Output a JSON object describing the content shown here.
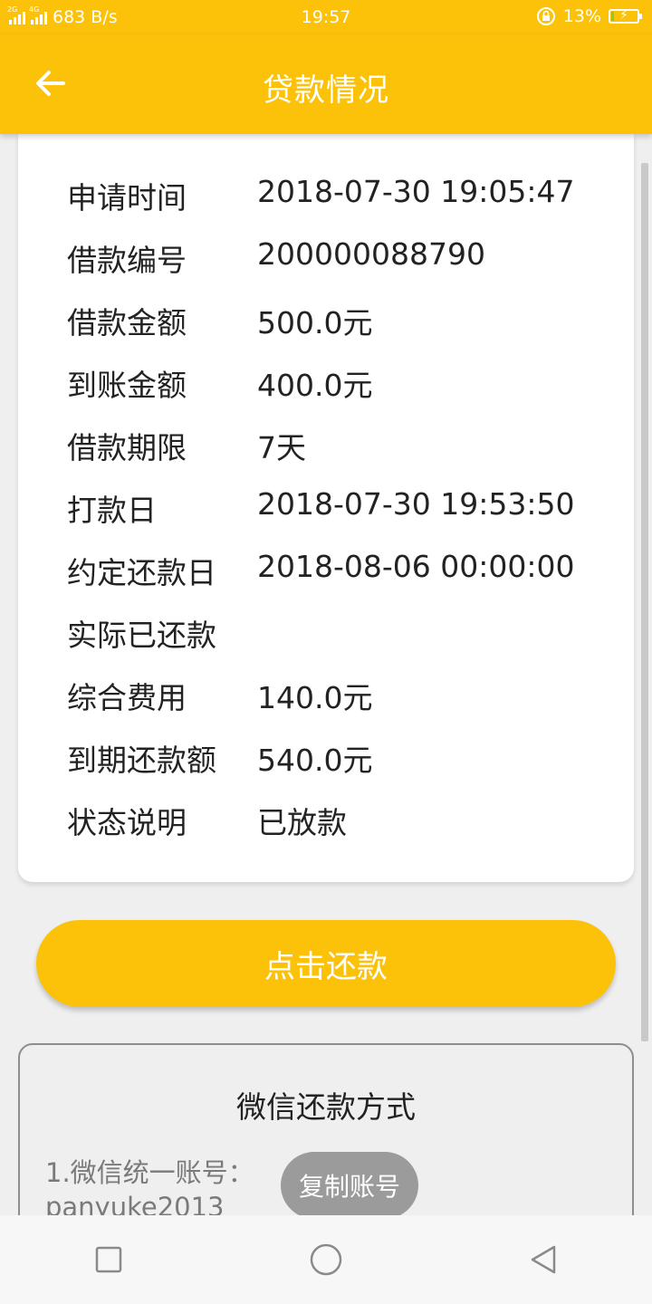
{
  "status_bar": {
    "net_speed": "683 B/s",
    "time": "19:57",
    "battery": "13%",
    "battery_level": 0.13,
    "signal_1_tag": "2G",
    "signal_2_tag": "4G"
  },
  "app_bar": {
    "title": "贷款情况",
    "back_icon": "arrow-left-icon"
  },
  "loan_details": [
    {
      "label": "申请时间",
      "value": "2018-07-30 19:05:47"
    },
    {
      "label": "借款编号",
      "value": "200000088790"
    },
    {
      "label": "借款金额",
      "value": "500.0元"
    },
    {
      "label": "到账金额",
      "value": "400.0元"
    },
    {
      "label": "借款期限",
      "value": "7天"
    },
    {
      "label": "打款日",
      "value": "2018-07-30 19:53:50"
    },
    {
      "label": "约定还款日",
      "value": "2018-08-06 00:00:00"
    },
    {
      "label": "实际已还款",
      "value": ""
    },
    {
      "label": "综合费用",
      "value": "140.0元"
    },
    {
      "label": "到期还款额",
      "value": "540.0元"
    },
    {
      "label": "状态说明",
      "value": "已放款"
    }
  ],
  "repay_button": {
    "label": "点击还款"
  },
  "wechat": {
    "heading": "微信还款方式",
    "account_label": "1.微信统一账号：",
    "account_value": "panyuke2013",
    "copy_label": "复制账号"
  },
  "colors": {
    "accent": "#fcc20a",
    "copy_button": "#9b9b9b",
    "background": "#efefef"
  }
}
